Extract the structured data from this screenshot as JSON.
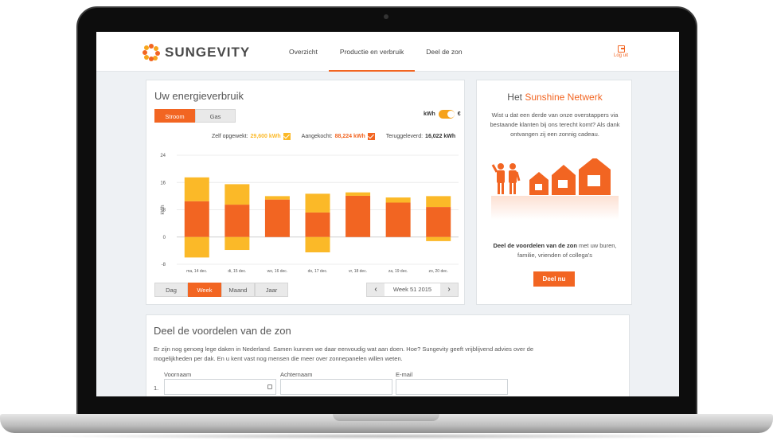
{
  "header": {
    "brand": "SUNGEVITY",
    "nav": [
      "Overzicht",
      "Productie en verbruik",
      "Deel de zon"
    ],
    "active_nav": 1,
    "logout_label": "Log uit"
  },
  "energy": {
    "title": "Uw energieverbruik",
    "tabs": [
      "Stroom",
      "Gas"
    ],
    "unit_kwh": "kWh",
    "unit_euro": "€",
    "legend": {
      "self_label": "Zelf opgewekt:",
      "self_value": "29,600 kWh",
      "bought_label": "Aangekocht:",
      "bought_value": "88,224 kWh",
      "returned_label": "Teruggeleverd:",
      "returned_value": "16,022 kWh"
    },
    "period_tabs": [
      "Dag",
      "Week",
      "Maand",
      "Jaar"
    ],
    "week_label": "Week 51 2015"
  },
  "chart_data": {
    "type": "bar",
    "ylabel": "kWh",
    "ylim": [
      -8,
      24
    ],
    "yticks": [
      24,
      16,
      8,
      0,
      -8
    ],
    "categories": [
      "ma, 14 dec.",
      "di, 15 dec.",
      "wo, 16 dec.",
      "do, 17 dec.",
      "vr, 18 dec.",
      "za, 19 dec.",
      "zo, 20 dec."
    ],
    "series": [
      {
        "name": "Aangekocht",
        "color": "#f26522",
        "values": [
          10.5,
          9.5,
          11,
          7.2,
          12.1,
          10.1,
          8.8
        ]
      },
      {
        "name": "Zelf opgewekt",
        "color": "#fbb928",
        "values": [
          7.0,
          6.0,
          1.0,
          5.5,
          1.0,
          1.5,
          3.2
        ]
      },
      {
        "name": "Teruggeleverd",
        "color": "#fbb928",
        "values": [
          -6.0,
          -3.8,
          0,
          -4.5,
          0,
          0,
          -1.2
        ]
      }
    ]
  },
  "sunshine": {
    "title_prefix": "Het",
    "title_highlight": "Sunshine Netwerk",
    "text": "Wist u dat een derde van onze overstappers via bestaande klanten bij ons terecht komt? Als dank ontvangen zij een zonnig cadeau.",
    "bottom_bold": "Deel de voordelen van de zon",
    "bottom_rest": " met uw buren, familie, vrienden of collega's",
    "button": "Deel nu"
  },
  "share": {
    "title": "Deel de voordelen van de zon",
    "desc": "Er zijn nog genoeg lege daken in Nederland. Samen kunnen we daar eenvoudig wat aan doen. Hoe? Sungevity geeft vrijblijvend advies over de mogelijkheden per dak. En u kent vast nog mensen die meer over zonnepanelen willen weten.",
    "row_number": "1.",
    "fields": [
      {
        "label": "Voornaam",
        "value": ""
      },
      {
        "label": "Achternaam",
        "value": ""
      },
      {
        "label": "E-mail",
        "value": ""
      }
    ]
  },
  "colors": {
    "accent": "#f26522",
    "accent_light": "#fbb928"
  }
}
